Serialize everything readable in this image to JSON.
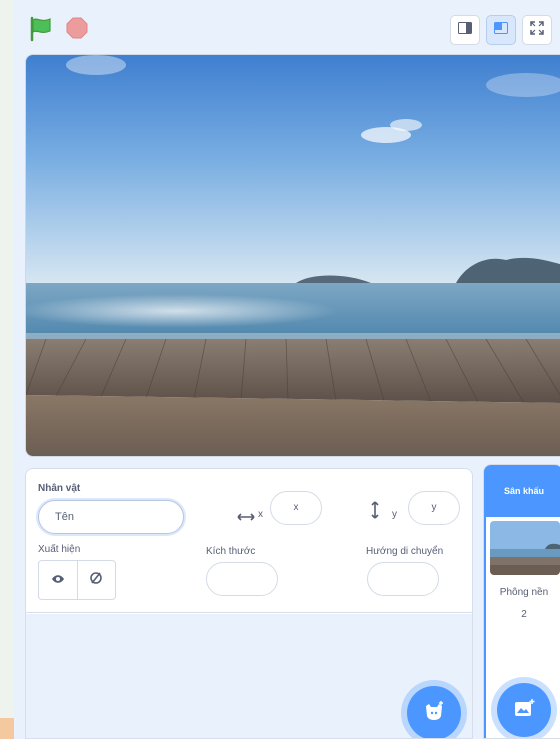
{
  "stage_controls": {
    "green_flag_icon": "green-flag-icon",
    "stop_icon": "stop-icon",
    "colors": {
      "flag": "#4cbf56",
      "stop": "#ec9c9c"
    }
  },
  "layout_modes": [
    {
      "name": "small-stage-icon",
      "active": false
    },
    {
      "name": "normal-stage-icon",
      "active": true
    },
    {
      "name": "fullscreen-icon",
      "active": false
    }
  ],
  "sprite_info": {
    "heading": "Nhân vật",
    "name_placeholder": "Tên",
    "x_label": "x",
    "x_value": "x",
    "y_label": "y",
    "y_value": "y",
    "show_label": "Xuất hiện",
    "size_label": "Kích thước",
    "direction_label": "Hướng di chuyển"
  },
  "stage_selector": {
    "header": "Sân khấu",
    "backdrop_label": "Phông nền",
    "backdrop_count": "2"
  },
  "colors": {
    "accent": "#4c97ff",
    "panel_bg": "#e9f1fc",
    "text": "#575e75"
  }
}
